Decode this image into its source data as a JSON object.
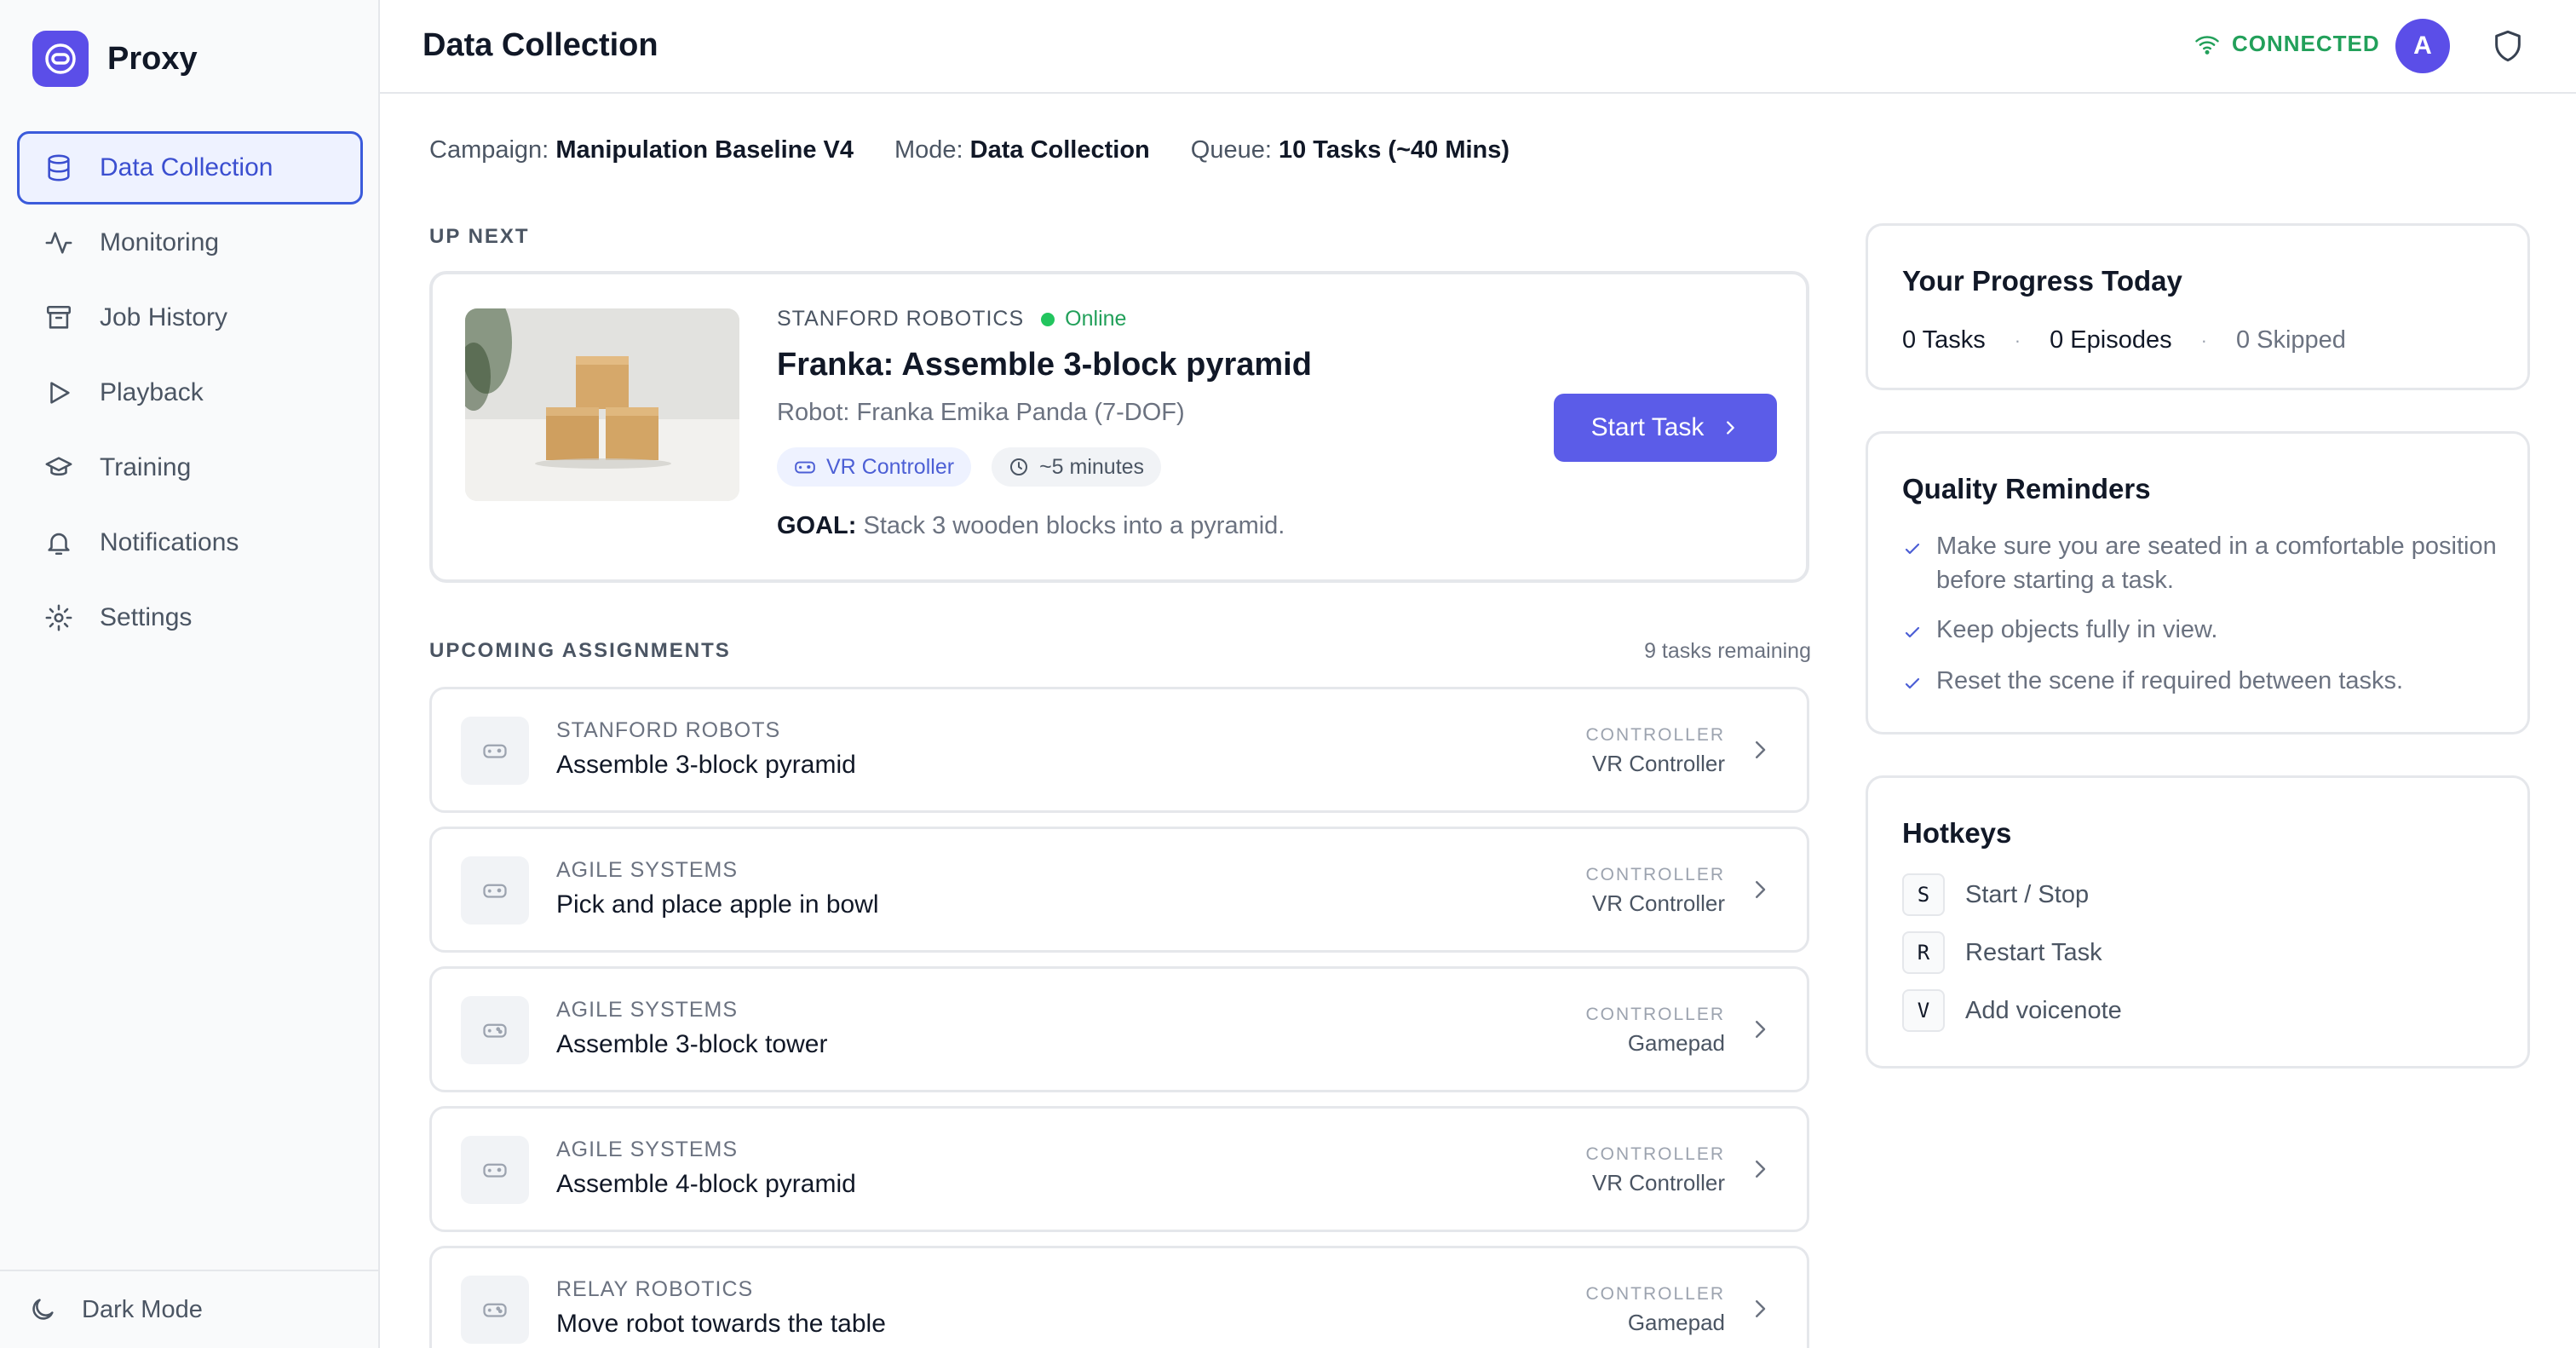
{
  "app": {
    "name": "Proxy"
  },
  "sidebar": {
    "items": [
      {
        "label": "Data Collection",
        "icon": "database-icon",
        "active": true
      },
      {
        "label": "Monitoring",
        "icon": "activity-icon"
      },
      {
        "label": "Job History",
        "icon": "archive-icon"
      },
      {
        "label": "Playback",
        "icon": "play-icon"
      },
      {
        "label": "Training",
        "icon": "graduation-cap-icon"
      },
      {
        "label": "Notifications",
        "icon": "bell-icon"
      },
      {
        "label": "Settings",
        "icon": "gear-icon"
      }
    ],
    "footer_label": "Dark Mode"
  },
  "header": {
    "title": "Data Collection",
    "status": "CONNECTED",
    "avatar_initial": "A"
  },
  "meta": {
    "campaign_label": "Campaign:",
    "campaign_value": "Manipulation Baseline V4",
    "mode_label": "Mode:",
    "mode_value": "Data Collection",
    "queue_label": "Queue:",
    "queue_value": "10 Tasks (~40 Mins)"
  },
  "up_next": {
    "section_label": "UP NEXT",
    "org": "STANFORD ROBOTICS",
    "status": "Online",
    "title": "Franka: Assemble 3-block pyramid",
    "robot": "Robot: Franka Emika Panda (7-DOF)",
    "controller_chip": "VR Controller",
    "duration_chip": "~5 minutes",
    "goal_label": "GOAL:",
    "goal_text": "Stack 3 wooden blocks into a pyramid.",
    "start_label": "Start Task"
  },
  "assignments": {
    "section_label": "UPCOMING ASSIGNMENTS",
    "remaining": "9 tasks remaining",
    "controller_label": "CONTROLLER",
    "items": [
      {
        "org": "STANFORD ROBOTS",
        "title": "Assemble 3-block pyramid",
        "controller": "VR Controller"
      },
      {
        "org": "AGILE SYSTEMS",
        "title": "Pick and place apple in bowl",
        "controller": "VR Controller"
      },
      {
        "org": "AGILE SYSTEMS",
        "title": "Assemble 3-block tower",
        "controller": "Gamepad"
      },
      {
        "org": "AGILE SYSTEMS",
        "title": "Assemble 4-block pyramid",
        "controller": "VR Controller"
      },
      {
        "org": "RELAY ROBOTICS",
        "title": "Move robot towards the table",
        "controller": "Gamepad"
      }
    ]
  },
  "progress": {
    "title": "Your Progress Today",
    "tasks": "0 Tasks",
    "episodes": "0 Episodes",
    "skipped": "0 Skipped"
  },
  "reminders": {
    "title": "Quality Reminders",
    "items": [
      "Make sure you are seated in a comfortable position before starting a task.",
      "Keep objects fully in view.",
      "Reset the scene if required between tasks."
    ]
  },
  "hotkeys": {
    "title": "Hotkeys",
    "items": [
      {
        "key": "S",
        "label": "Start / Stop"
      },
      {
        "key": "R",
        "label": "Restart Task"
      },
      {
        "key": "V",
        "label": "Add voicenote"
      }
    ]
  },
  "colors": {
    "accent": "#5b4ee8",
    "active_border": "#3b5bdb",
    "connected": "#22a05a"
  }
}
